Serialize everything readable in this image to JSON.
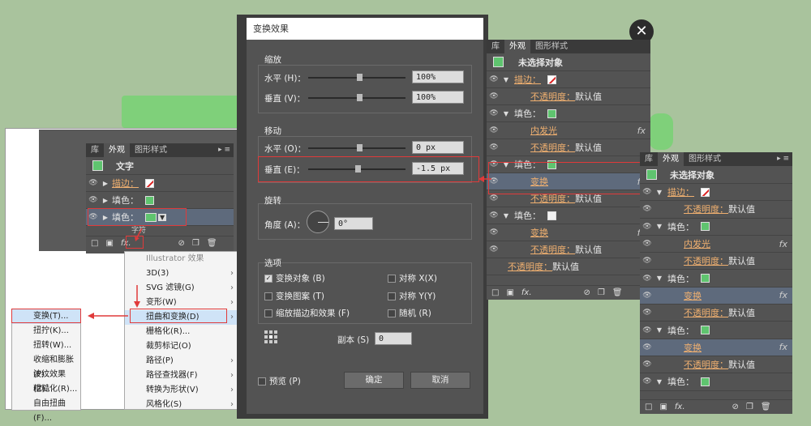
{
  "background_letters": "T",
  "panel_left": {
    "tabs": [
      "库",
      "外观",
      "图形样式"
    ],
    "menu_icon": "▸ ≡",
    "header_label": "文字",
    "rows": [
      {
        "label": "描边：",
        "swatch": "stroke"
      },
      {
        "label": "填色：",
        "swatch": "green"
      },
      {
        "label": "填色：",
        "swatch": "green"
      }
    ],
    "cut_label": "字符",
    "fx_label": "fx."
  },
  "effect_menu": {
    "header": "Illustrator 效果",
    "items": [
      "3D(3)",
      "SVG 滤镜(G)",
      "变形(W)",
      "扭曲和变换(D)",
      "栅格化(R)...",
      "裁剪标记(O)",
      "路径(P)",
      "路径查找器(F)",
      "转换为形状(V)",
      "风格化(S)"
    ]
  },
  "distort_submenu": {
    "items": [
      "变换(T)...",
      "扭拧(K)...",
      "扭转(W)...",
      "收缩和膨胀(P)...",
      "波纹效果(Z)...",
      "粗糙化(R)...",
      "自由扭曲(F)..."
    ]
  },
  "dialog": {
    "title": "变换效果",
    "scale": {
      "label": "缩放",
      "horizontal_label": "水平 (H)：",
      "horizontal_value": "100%",
      "vertical_label": "垂直 (V)：",
      "vertical_value": "100%"
    },
    "move": {
      "label": "移动",
      "horizontal_label": "水平 (O)：",
      "horizontal_value": "0 px",
      "vertical_label": "垂直 (E)：",
      "vertical_value": "-1.5 px"
    },
    "rotate": {
      "label": "旋转",
      "angle_label": "角度 (A)：",
      "angle_value": "0°"
    },
    "options": {
      "label": "选项",
      "transform_objects": "变换对象 (B)",
      "transform_patterns": "变换图案 (T)",
      "scale_strokes": "缩放描边和效果 (F)",
      "reflect_x": "对称 X(X)",
      "reflect_y": "对称 Y(Y)",
      "random": "随机 (R)"
    },
    "copies_label": "副本 (S)",
    "copies_value": "0",
    "preview_label": "预览 (P)",
    "ok_label": "确定",
    "cancel_label": "取消",
    "close_icon": "✕"
  },
  "panel_middle": {
    "tabs": [
      "库",
      "外观",
      "图形样式"
    ],
    "menu_icon": "▸ ≡",
    "header_label": "未选择对象",
    "rows": [
      {
        "kind": "prop",
        "label": "描边：",
        "swatch": "stroke"
      },
      {
        "kind": "sub",
        "label": "不透明度：",
        "value": "默认值"
      },
      {
        "kind": "prop",
        "label": "填色：",
        "swatch": "green"
      },
      {
        "kind": "fx",
        "label": "内发光"
      },
      {
        "kind": "sub",
        "label": "不透明度：",
        "value": "默认值"
      },
      {
        "kind": "prop",
        "label": "填色：",
        "swatch": "green"
      },
      {
        "kind": "fx",
        "label": "变换",
        "selected": true
      },
      {
        "kind": "sub",
        "label": "不透明度：",
        "value": "默认值"
      },
      {
        "kind": "prop",
        "label": "填色：",
        "swatch": "white"
      },
      {
        "kind": "fx",
        "label": "变换"
      },
      {
        "kind": "sub",
        "label": "不透明度：",
        "value": "默认值"
      },
      {
        "kind": "sub0",
        "label": "不透明度：",
        "value": "默认值"
      }
    ],
    "fx_label": "fx."
  },
  "panel_right": {
    "tabs": [
      "库",
      "外观",
      "图形样式"
    ],
    "menu_icon": "▸ ≡",
    "header_label": "未选择对象",
    "rows": [
      {
        "kind": "prop",
        "label": "描边：",
        "swatch": "stroke"
      },
      {
        "kind": "sub",
        "label": "不透明度：",
        "value": "默认值"
      },
      {
        "kind": "prop",
        "label": "填色：",
        "swatch": "green"
      },
      {
        "kind": "fx",
        "label": "内发光"
      },
      {
        "kind": "sub",
        "label": "不透明度：",
        "value": "默认值"
      },
      {
        "kind": "prop",
        "label": "填色：",
        "swatch": "green"
      },
      {
        "kind": "fx",
        "label": "变换",
        "selected": true
      },
      {
        "kind": "sub",
        "label": "不透明度：",
        "value": "默认值"
      },
      {
        "kind": "prop",
        "label": "填色：",
        "swatch": "green"
      },
      {
        "kind": "fx",
        "label": "变换",
        "selected": true
      },
      {
        "kind": "sub",
        "label": "不透明度：",
        "value": "默认值"
      },
      {
        "kind": "prop",
        "label": "填色：",
        "swatch": "green"
      }
    ],
    "fx_label": "fx."
  },
  "colors": {
    "accent_red": "#e03a3a",
    "link_orange": "#f0b070",
    "fill_green": "#5fc46f"
  }
}
